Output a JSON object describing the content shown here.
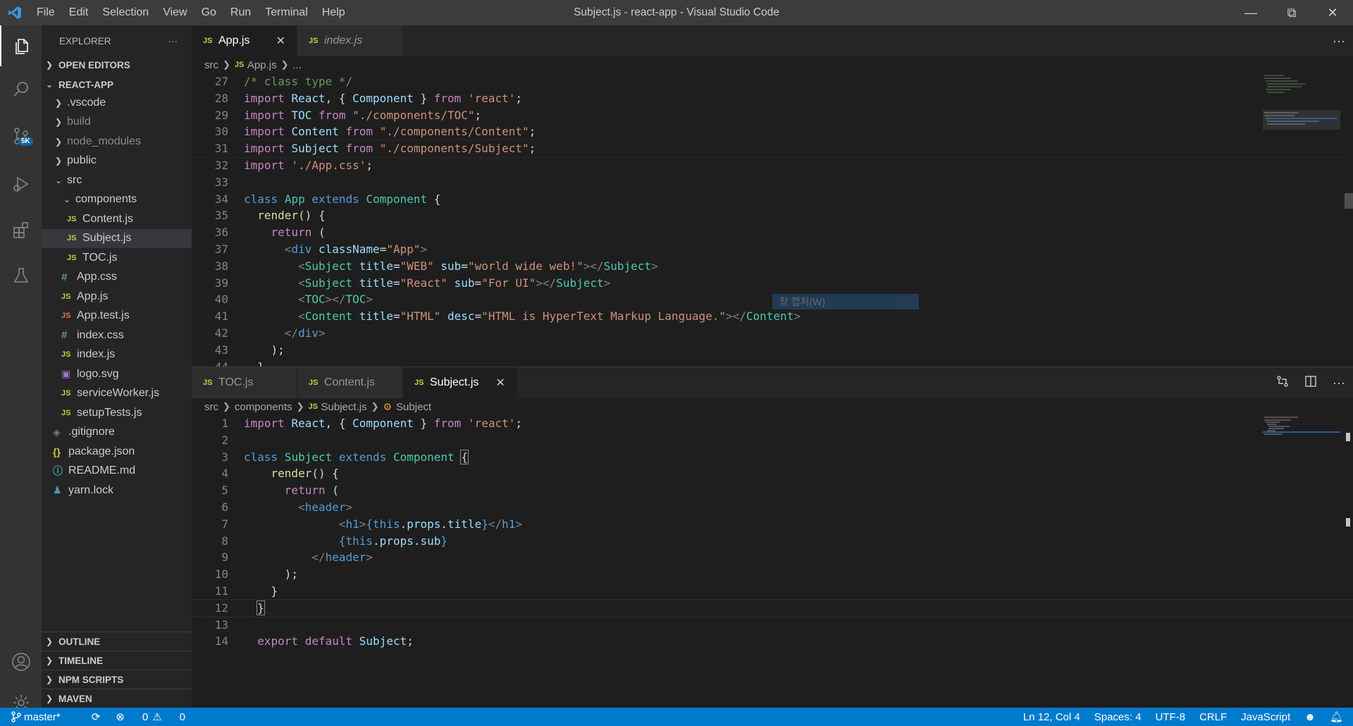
{
  "window": {
    "title": "Subject.js - react-app - Visual Studio Code",
    "menu": [
      "File",
      "Edit",
      "Selection",
      "View",
      "Go",
      "Run",
      "Terminal",
      "Help"
    ]
  },
  "activity": {
    "scm_badge": "5K",
    "icons": [
      "explorer-icon",
      "search-icon",
      "source-control-icon",
      "run-debug-icon",
      "extensions-icon",
      "testing-icon",
      "account-icon",
      "settings-gear-icon"
    ]
  },
  "sidebar": {
    "title": "EXPLORER",
    "more": "···",
    "open_editors": "OPEN EDITORS",
    "project": "REACT-APP",
    "items": [
      {
        "label": ".vscode",
        "type": "folder",
        "indent": 1
      },
      {
        "label": "build",
        "type": "folder",
        "indent": 1
      },
      {
        "label": "node_modules",
        "type": "folder",
        "indent": 1
      },
      {
        "label": "public",
        "type": "folder",
        "indent": 1
      },
      {
        "label": "src",
        "type": "folder-open",
        "indent": 1
      },
      {
        "label": "components",
        "type": "folder-open",
        "indent": 2
      },
      {
        "label": "Content.js",
        "type": "js",
        "indent": 3
      },
      {
        "label": "Subject.js",
        "type": "js",
        "indent": 3
      },
      {
        "label": "TOC.js",
        "type": "js",
        "indent": 3
      },
      {
        "label": "App.css",
        "type": "css",
        "indent": 2
      },
      {
        "label": "App.js",
        "type": "js",
        "indent": 2
      },
      {
        "label": "App.test.js",
        "type": "jstest",
        "indent": 2
      },
      {
        "label": "index.css",
        "type": "css",
        "indent": 2
      },
      {
        "label": "index.js",
        "type": "js",
        "indent": 2
      },
      {
        "label": "logo.svg",
        "type": "svg",
        "indent": 2
      },
      {
        "label": "serviceWorker.js",
        "type": "js",
        "indent": 2
      },
      {
        "label": "setupTests.js",
        "type": "js",
        "indent": 2
      },
      {
        "label": ".gitignore",
        "type": "git",
        "indent": 1
      },
      {
        "label": "package.json",
        "type": "json",
        "indent": 1
      },
      {
        "label": "README.md",
        "type": "info",
        "indent": 1
      },
      {
        "label": "yarn.lock",
        "type": "yarn",
        "indent": 1
      }
    ],
    "sections": [
      "OUTLINE",
      "TIMELINE",
      "NPM SCRIPTS",
      "MAVEN"
    ]
  },
  "top_group": {
    "tabs": [
      {
        "label": "App.js",
        "icon": "JS",
        "close": "✕"
      },
      {
        "label": "index.js",
        "icon": "JS"
      }
    ],
    "more": "···",
    "breadcrumb": [
      "src",
      "App.js",
      "..."
    ]
  },
  "bottom_group": {
    "tabs": [
      {
        "label": "TOC.js",
        "icon": "JS"
      },
      {
        "label": "Content.js",
        "icon": "JS"
      },
      {
        "label": "Subject.js",
        "icon": "JS",
        "close": "✕"
      }
    ],
    "more": "···",
    "breadcrumb": [
      "src",
      "components",
      "Subject.js",
      "Subject"
    ]
  },
  "tooltip": "창 캡처(W)",
  "status": {
    "branch": "master*",
    "errors": "0",
    "warnings": "0",
    "position": "Ln 12, Col 4",
    "spaces": "Spaces: 4",
    "encoding": "UTF-8",
    "eol": "CRLF",
    "language": "JavaScript"
  },
  "colors": {
    "statusbar": "#007acc",
    "activitybar": "#333333",
    "sidebar": "#252526",
    "editor": "#1e1e1e"
  }
}
